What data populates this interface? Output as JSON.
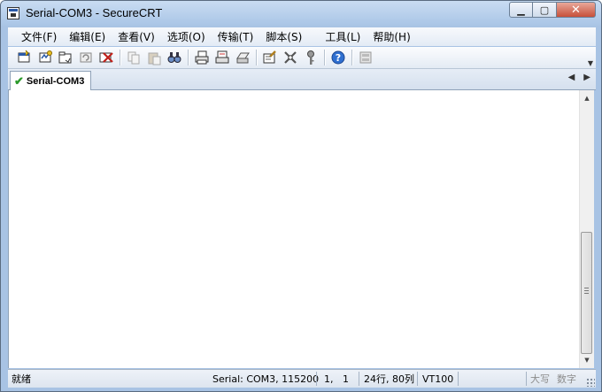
{
  "window": {
    "title": "Serial-COM3 - SecureCRT",
    "controls": {
      "minimize": "▁",
      "maximize": "▢",
      "close": "✕"
    }
  },
  "menu": [
    "文件(F)",
    "编辑(E)",
    "查看(V)",
    "选项(O)",
    "传输(T)",
    "脚本(S)",
    "工具(L)",
    "帮助(H)"
  ],
  "toolbar": {
    "icons": [
      "connect-icon",
      "quick-connect-icon",
      "connect-tab-icon",
      "reconnect-icon",
      "disconnect-icon",
      "copy-icon",
      "paste-icon",
      "find-icon",
      "print-icon",
      "print-selection-icon",
      "print-setup-icon",
      "session-options-icon",
      "global-options-icon",
      "keymap-icon",
      "help-icon",
      "sftp-icon"
    ]
  },
  "tabs": [
    {
      "label": "Serial-COM3",
      "status": "connected"
    }
  ],
  "scrollbar": {
    "position": 1.0
  },
  "statusbar": {
    "state": "就绪",
    "connection": "Serial: COM3, 115200",
    "cursor": "1,   1",
    "size": "24行, 80列",
    "emulation": "VT100",
    "caps": "大写",
    "num": "数字"
  },
  "colors": {
    "accent": "#a8c3e4",
    "tab_check": "#2b9a2b"
  }
}
